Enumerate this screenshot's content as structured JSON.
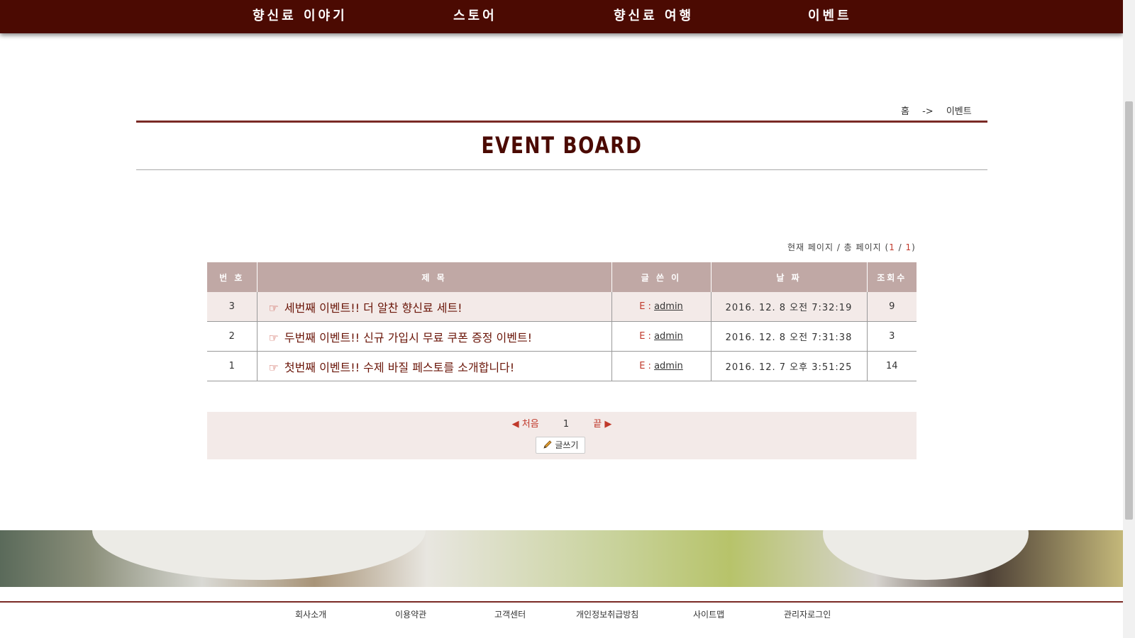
{
  "nav": {
    "items": [
      "향신료 이야기",
      "스토어",
      "향신료 여행",
      "이벤트"
    ]
  },
  "breadcrumb": {
    "home": "홈",
    "sep": "->",
    "current": "이벤트"
  },
  "page": {
    "title": "EVENT BOARD"
  },
  "page_info": {
    "label": "현재 페이지 / 총 페이지",
    "open": "(",
    "current": "1",
    "slash": "/",
    "total": "1",
    "close": ")"
  },
  "table": {
    "headers": [
      "번 호",
      "제 목",
      "글 쓴 이",
      "날 짜",
      "조회수"
    ],
    "rows": [
      {
        "num": "3",
        "icon": "☞",
        "title": "세번째 이벤트!! 더 알찬 향신료 세트!",
        "author_prefix": "E :",
        "author": "admin",
        "date": "2016. 12. 8 오전 7:32:19",
        "views": "9"
      },
      {
        "num": "2",
        "icon": "☞",
        "title": "두번째 이벤트!! 신규 가입시 무료 쿠폰 증정 이벤트!",
        "author_prefix": "E :",
        "author": "admin",
        "date": "2016. 12. 8 오전 7:31:38",
        "views": "3"
      },
      {
        "num": "1",
        "icon": "☞",
        "title": "첫번째 이벤트!! 수제 바질 페스토를 소개합니다!",
        "author_prefix": "E :",
        "author": "admin",
        "date": "2016. 12. 7 오후 3:51:25",
        "views": "14"
      }
    ]
  },
  "pager": {
    "first": "◀ 처음",
    "current": "1",
    "last": "끝 ▶",
    "write": "글쓰기",
    "write_icon": "pencil-icon"
  },
  "footer": {
    "links": [
      "회사소개",
      "이용약관",
      "고객센터",
      "개인정보취급방침",
      "사이트맵",
      "관리자로그인"
    ]
  },
  "colors": {
    "nav_bg": "#4b0a02",
    "accent": "#c0392b",
    "header_bg": "#c0a8a5",
    "highlight_row": "#f3eae8"
  }
}
